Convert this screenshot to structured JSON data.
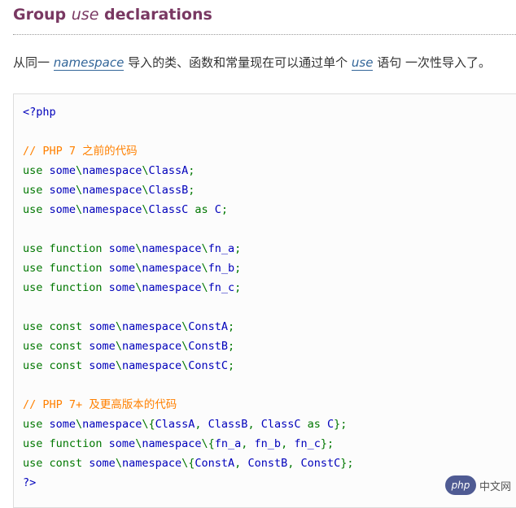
{
  "heading": {
    "prefix": "Group ",
    "keyword": "use",
    "suffix": " declarations"
  },
  "intro": {
    "part1": "从同一 ",
    "link1": "namespace",
    "part2": " 导入的类、函数和常量现在可以通过单个 ",
    "link2": "use",
    "part3": " 语句 一次性导入了。"
  },
  "code_lines": [
    "<?php",
    "",
    "// PHP 7 之前的代码",
    "use some\\namespace\\ClassA;",
    "use some\\namespace\\ClassB;",
    "use some\\namespace\\ClassC as C;",
    "",
    "use function some\\namespace\\fn_a;",
    "use function some\\namespace\\fn_b;",
    "use function some\\namespace\\fn_c;",
    "",
    "use const some\\namespace\\ConstA;",
    "use const some\\namespace\\ConstB;",
    "use const some\\namespace\\ConstC;",
    "",
    "// PHP 7+ 及更高版本的代码",
    "use some\\namespace\\{ClassA, ClassB, ClassC as C};",
    "use function some\\namespace\\{fn_a, fn_b, fn_c};",
    "use const some\\namespace\\{ConstA, ConstB, ConstC};",
    "?>"
  ],
  "watermark": {
    "logo_text": "php",
    "text": "中文网"
  },
  "colors": {
    "heading": "#793862",
    "comment": "#ff8000",
    "keyword": "#007700",
    "name": "#0000bb"
  }
}
